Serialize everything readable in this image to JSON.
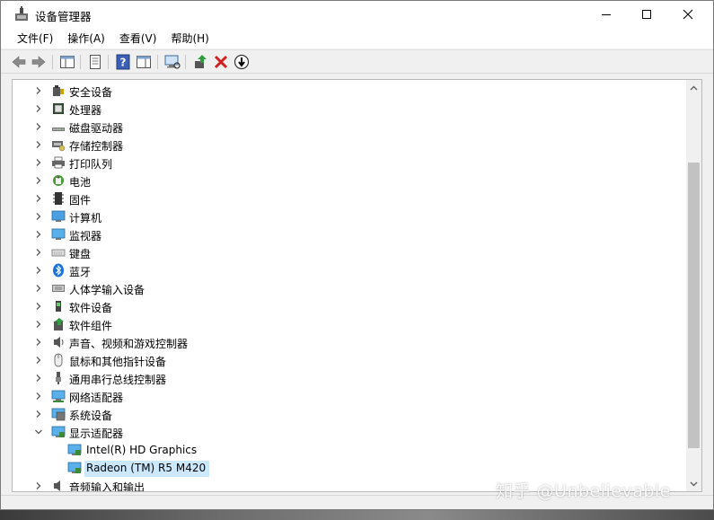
{
  "window": {
    "title": "设备管理器",
    "accent": "#cce8ff"
  },
  "menu": [
    {
      "label": "文件(F)"
    },
    {
      "label": "操作(A)"
    },
    {
      "label": "查看(V)"
    },
    {
      "label": "帮助(H)"
    }
  ],
  "toolbar": {
    "buttons": [
      "back-arrow-icon",
      "forward-arrow-icon",
      "show-hide-tree-icon",
      "properties-icon",
      "help-icon",
      "action-pane-icon",
      "scan-hardware-icon",
      "update-driver-icon",
      "uninstall-icon",
      "disable-icon"
    ]
  },
  "tree": {
    "categories": [
      {
        "label": "安全设备",
        "icon": "security-device-icon"
      },
      {
        "label": "处理器",
        "icon": "processor-icon"
      },
      {
        "label": "磁盘驱动器",
        "icon": "disk-drive-icon"
      },
      {
        "label": "存储控制器",
        "icon": "storage-controller-icon"
      },
      {
        "label": "打印队列",
        "icon": "printer-icon"
      },
      {
        "label": "电池",
        "icon": "battery-icon"
      },
      {
        "label": "固件",
        "icon": "firmware-icon"
      },
      {
        "label": "计算机",
        "icon": "computer-icon"
      },
      {
        "label": "监视器",
        "icon": "monitor-icon"
      },
      {
        "label": "键盘",
        "icon": "keyboard-icon"
      },
      {
        "label": "蓝牙",
        "icon": "bluetooth-icon"
      },
      {
        "label": "人体学输入设备",
        "icon": "hid-icon"
      },
      {
        "label": "软件设备",
        "icon": "software-device-icon"
      },
      {
        "label": "软件组件",
        "icon": "software-component-icon"
      },
      {
        "label": "声音、视频和游戏控制器",
        "icon": "sound-icon"
      },
      {
        "label": "鼠标和其他指针设备",
        "icon": "mouse-icon"
      },
      {
        "label": "通用串行总线控制器",
        "icon": "usb-icon"
      },
      {
        "label": "网络适配器",
        "icon": "network-adapter-icon"
      },
      {
        "label": "系统设备",
        "icon": "system-device-icon"
      }
    ],
    "display_adapters": {
      "label": "显示适配器",
      "children": [
        {
          "label": "Intel(R) HD Graphics"
        },
        {
          "label": "Radeon (TM) R5 M420"
        }
      ]
    },
    "partial_item": {
      "label": "音频输入和输出"
    }
  },
  "watermark": "知乎 @Unbelievable"
}
